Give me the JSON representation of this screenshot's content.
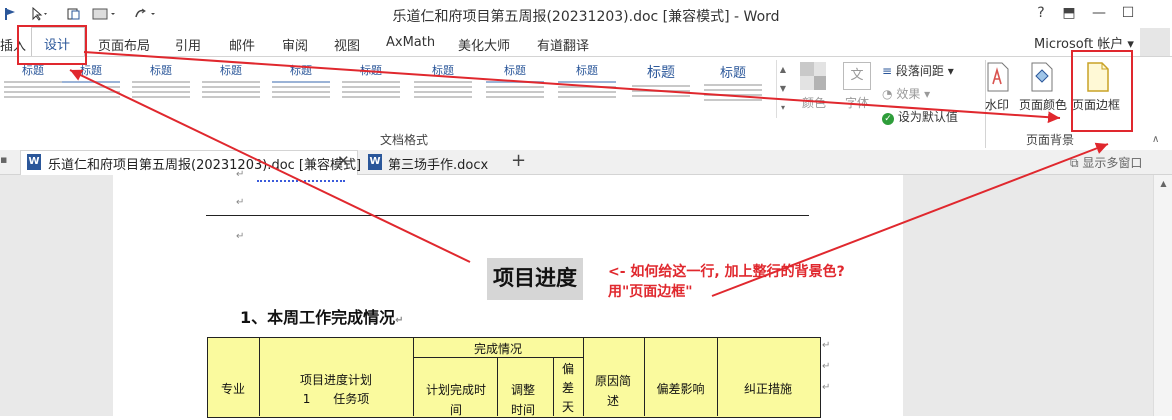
{
  "window": {
    "title": "乐道仁和府项目第五周报(20231203).doc [兼容模式] - Word",
    "controls": [
      "?",
      "⬒",
      "—",
      "☐"
    ]
  },
  "ribbon_tabs": [
    "插入",
    "设计",
    "页面布局",
    "引用",
    "邮件",
    "审阅",
    "视图",
    "AxMath",
    "美化大师",
    "有道翻译"
  ],
  "account": "Microsoft 帐户",
  "style_gallery": {
    "thumbnails": [
      "标题",
      "标题",
      "标题",
      "标题",
      "标题",
      "标题",
      "标题",
      "标题",
      "标题",
      "标题",
      "标题"
    ],
    "group_label": "文档格式"
  },
  "design_commands": {
    "colors": "颜色",
    "fonts": "字体",
    "paragraph_spacing": "段落间距",
    "effects": "效果",
    "set_default": "设为默认值"
  },
  "page_background": {
    "watermark": "水印",
    "page_color": "页面颜色",
    "page_borders": "页面边框",
    "group_label": "页面背景"
  },
  "doc_tabs": {
    "tab1": "乐道仁和府项目第五周报(20231203).doc [兼容模式]",
    "tab2": "第三场手作.docx",
    "add": "+",
    "multi_window": "显示多窗口"
  },
  "document": {
    "heading": "项目进度",
    "section": "1、本周工作完成情况",
    "table": {
      "col_major": "专业",
      "col_plan": "项目进度计划",
      "col_plan_sub": "1      任务项",
      "col_completion": "完成情况",
      "col_planned_time": "计划完成时间",
      "col_adjusted": "调整时间",
      "col_deviation_days": "偏差天",
      "col_reason": "原因简述",
      "col_impact": "偏差影响",
      "col_correction": "纠正措施"
    }
  },
  "annotation": {
    "line1": "<- 如何给这一行, 加上整行的背景色?",
    "line2": "用\"页面边框\""
  },
  "colors": {
    "accent": "#2b579a",
    "annotation_red": "#e0282e",
    "table_fill": "#fafa9e",
    "heading_highlight": "#d6d6d6"
  }
}
